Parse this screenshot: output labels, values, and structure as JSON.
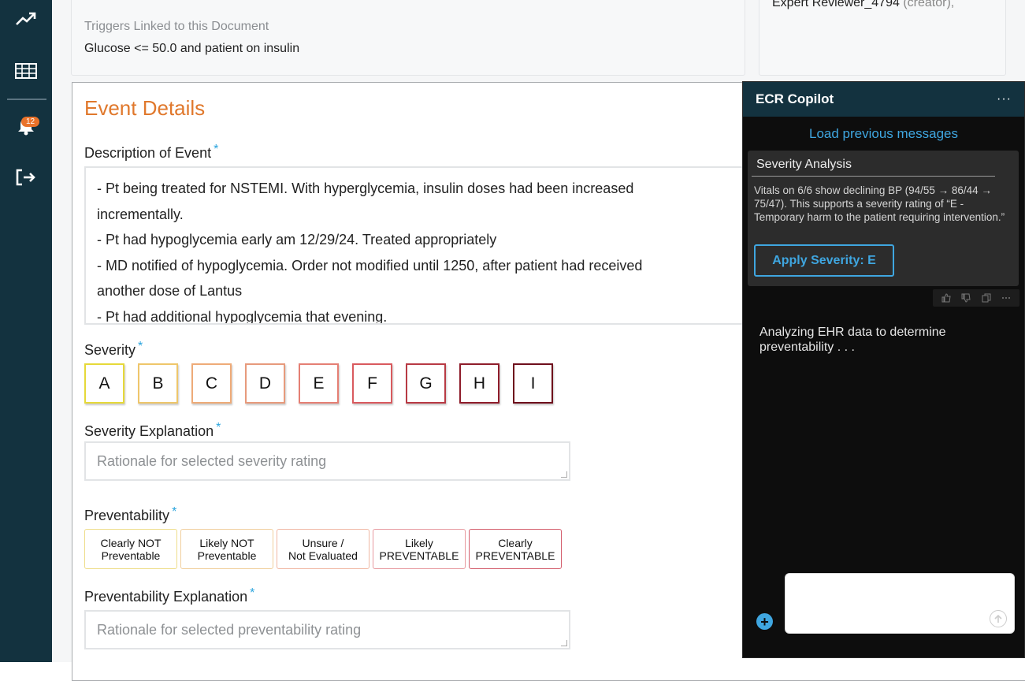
{
  "nav": {
    "items": [
      {
        "icon": "trending-up-icon"
      },
      {
        "icon": "table-icon"
      },
      {
        "icon": "bell-icon",
        "badge": "12"
      },
      {
        "icon": "logout-icon"
      }
    ]
  },
  "triggers": {
    "label": "Triggers Linked to this Document",
    "value": "Glucose <= 50.0 and patient on insulin"
  },
  "reviewers": {
    "name": "Expert Reviewer_4794",
    "role": "(creator),"
  },
  "event": {
    "title": "Event Details",
    "description_label": "Description of Event",
    "description_lines": [
      "- Pt being treated for NSTEMI.  With hyperglycemia, insulin doses had been increased",
      "incrementally.",
      "- Pt had hypoglycemia early am 12/29/24.  Treated appropriately",
      "- MD notified of hypoglycemia.  Order not modified until 1250, after patient had received",
      "another dose of Lantus",
      "- Pt had additional hypoglycemia that evening."
    ],
    "severity_label": "Severity",
    "severity_options": [
      {
        "label": "A",
        "color": "#e6d93a"
      },
      {
        "label": "B",
        "color": "#eec66b"
      },
      {
        "label": "C",
        "color": "#eeab78"
      },
      {
        "label": "D",
        "color": "#e79a7c"
      },
      {
        "label": "E",
        "color": "#e57f74"
      },
      {
        "label": "F",
        "color": "#d95a5e"
      },
      {
        "label": "G",
        "color": "#b83a44"
      },
      {
        "label": "H",
        "color": "#8f1d2b"
      },
      {
        "label": "I",
        "color": "#6e0f1c"
      }
    ],
    "severity_explanation_label": "Severity Explanation",
    "severity_explanation_placeholder": "Rationale for selected severity rating",
    "preventability_label": "Preventability",
    "preventability_options": [
      {
        "label": "Clearly NOT\nPreventable",
        "color": "#eedd8a"
      },
      {
        "label": "Likely NOT\nPreventable",
        "color": "#f0cf9d"
      },
      {
        "label": "Unsure /\nNot Evaluated",
        "color": "#f0b8a4"
      },
      {
        "label": "Likely\nPREVENTABLE",
        "color": "#e79aa0"
      },
      {
        "label": "Clearly\nPREVENTABLE",
        "color": "#d35d6c"
      }
    ],
    "preventability_explanation_label": "Preventability Explanation",
    "preventability_explanation_placeholder": "Rationale for selected preventability rating"
  },
  "copilot": {
    "title": "ECR Copilot",
    "menu": "···",
    "load_previous": "Load previous messages",
    "message": {
      "title": "Severity Analysis",
      "body": "Vitals on 6/6 show declining BP (94/55 → 86/44 → 75/47). This supports a severity  rating of “E - Temporary harm to the patient requiring intervention.”",
      "apply_label": "Apply Severity: E"
    },
    "actions": [
      "thumbs-up-icon",
      "thumbs-down-icon",
      "copy-icon",
      "more-icon"
    ],
    "status_text": "Analyzing EHR data to determine preventability . . .",
    "input_placeholder": ""
  }
}
